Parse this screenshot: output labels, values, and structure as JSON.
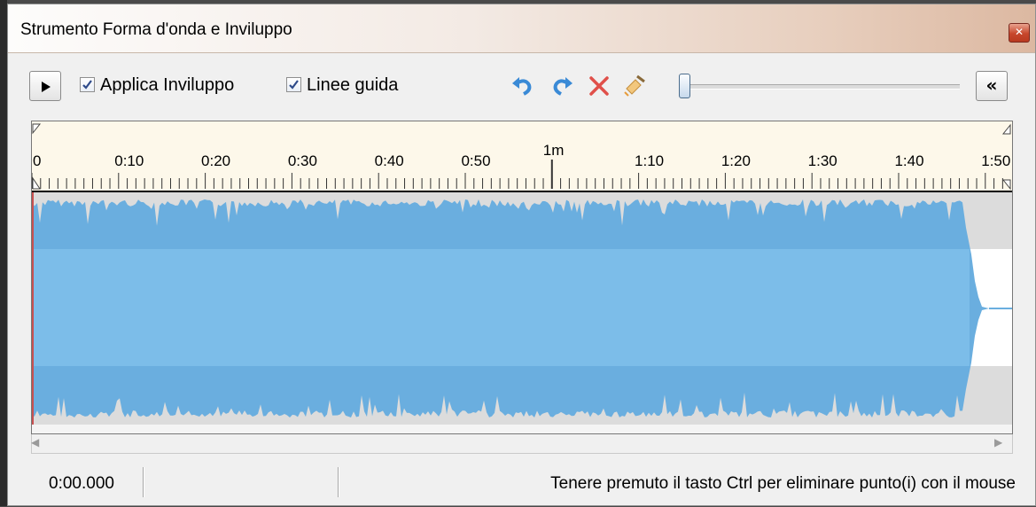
{
  "window": {
    "title": "Strumento Forma d'onda e Inviluppo",
    "close_icon": "close-icon"
  },
  "toolbar": {
    "play_icon": "play-icon",
    "apply_envelope": {
      "label": "Applica Inviluppo",
      "checked": true
    },
    "guides": {
      "label": "Linee guida",
      "checked": true
    },
    "undo_icon": "undo-icon",
    "redo_icon": "redo-icon",
    "delete_icon": "delete-x-icon",
    "clear_icon": "broom-icon",
    "zoom_slider": {
      "value": 0
    },
    "collapse_label": "«"
  },
  "ruler": {
    "labels": [
      "0",
      "0:10",
      "0:20",
      "0:30",
      "0:40",
      "0:50",
      "1m",
      "1:10",
      "1:20",
      "1:30",
      "1:40",
      "1:50"
    ]
  },
  "colors": {
    "waveform_fill": "#6aaedf",
    "waveform_center": "#7cbde9",
    "waveform_bg": "#dcdcdc",
    "ruler_bg": "#fdf8ea",
    "titlebar_accent": "#dcb8a1"
  },
  "status": {
    "time": "0:00.000",
    "message": "Tenere premuto il tasto Ctrl per eliminare punto(i) con il mouse"
  }
}
